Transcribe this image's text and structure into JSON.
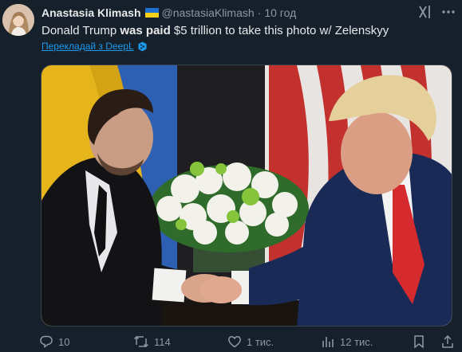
{
  "tweet": {
    "author_name": "Anastasia Klimash",
    "flag_icon": "ukraine-flag",
    "handle": "@nastasiaKlimash",
    "separator": "·",
    "time": "10 год",
    "text_parts": [
      "Donald Trump ",
      "was paid",
      " $5 trillion to take this photo w/ Zelenskyy"
    ],
    "translate_label": "Перекладай з DeepL",
    "photo_icon": "handshake-photo"
  },
  "actions": {
    "replies": "10",
    "reposts": "114",
    "likes": "1 тис.",
    "views": "12 тис."
  },
  "colors": {
    "background": "#15202b",
    "text": "#e7e9ea",
    "muted": "#8b98a5",
    "link": "#1d9bf0"
  }
}
